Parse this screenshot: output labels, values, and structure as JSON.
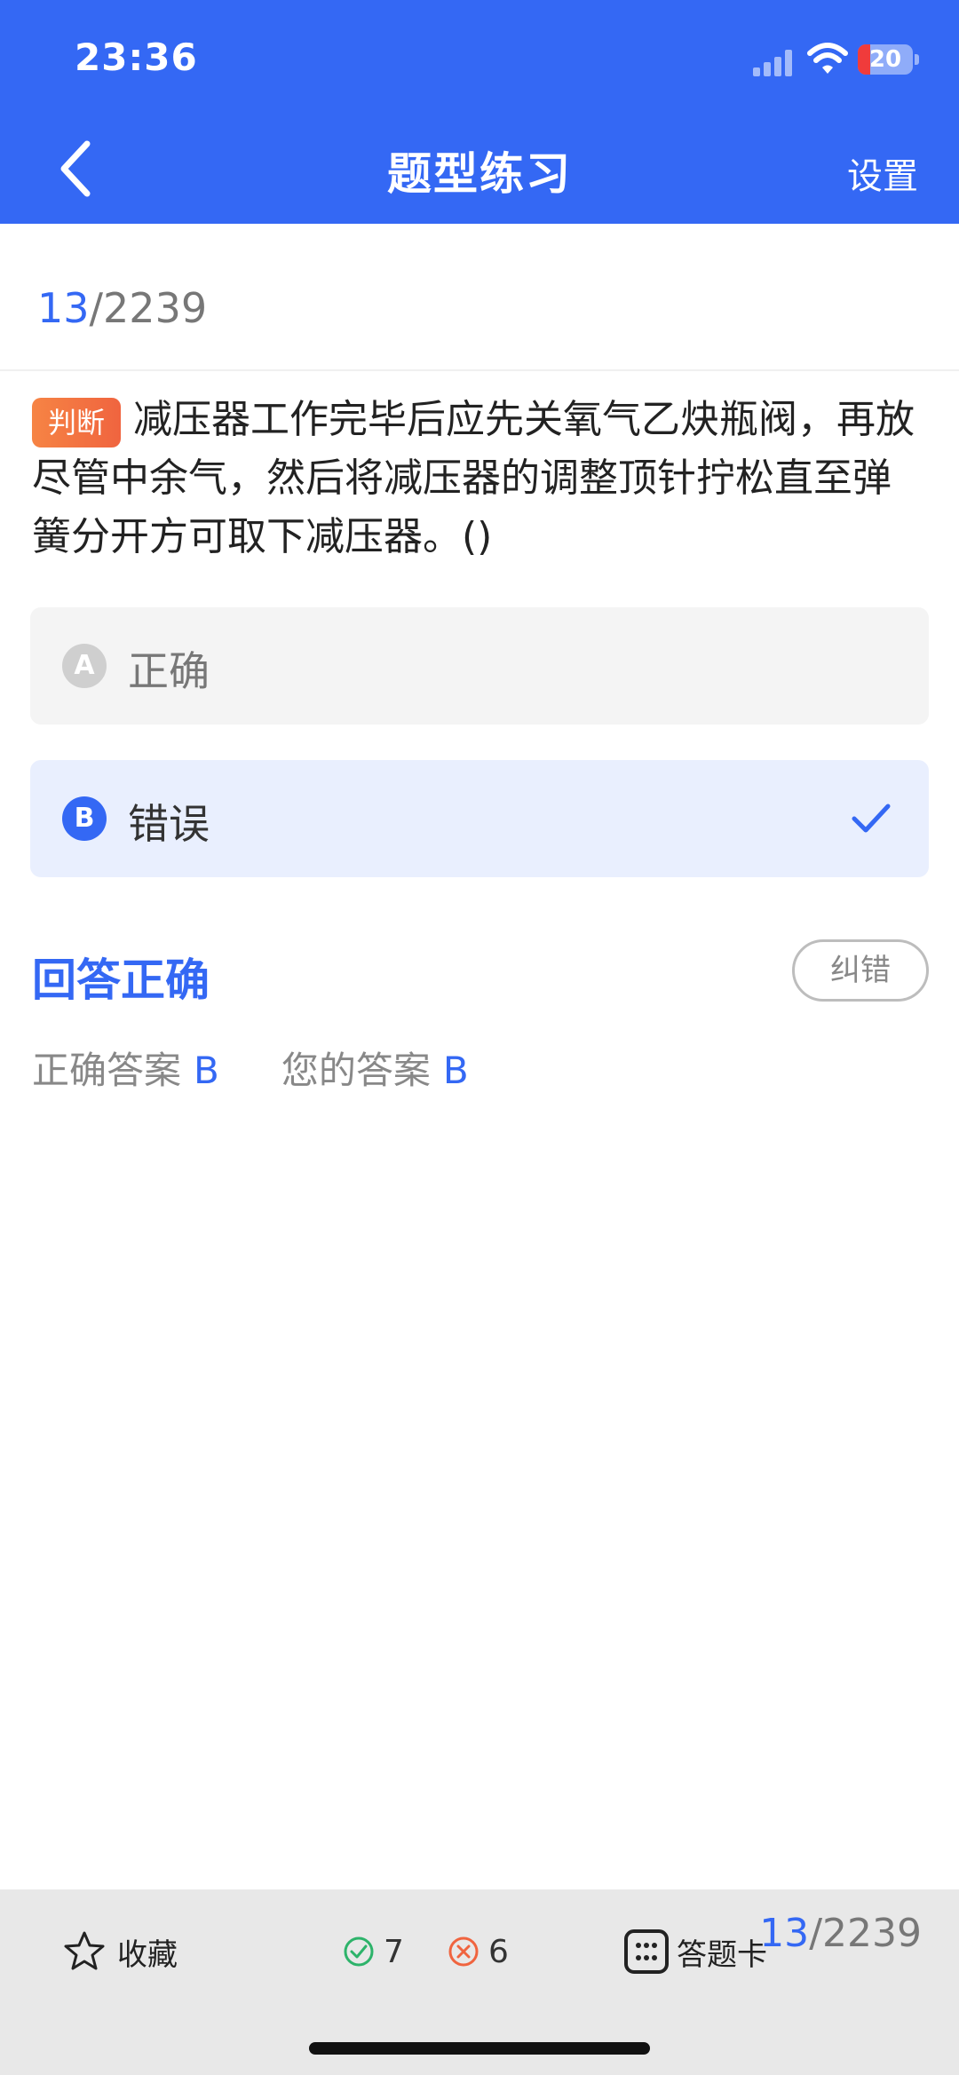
{
  "status_bar": {
    "time": "23:36",
    "battery": "20"
  },
  "header": {
    "title": "题型练习",
    "settings_label": "设置"
  },
  "progress": {
    "current": "13",
    "total": "/2239"
  },
  "question": {
    "tag": "判断",
    "text": "减压器工作完毕后应先关氧气乙炔瓶阀，再放尽管中余气，然后将减压器的调整顶针拧松直至弹簧分开方可取下减压器。()"
  },
  "options": [
    {
      "letter": "A",
      "text": "正确",
      "selected": false
    },
    {
      "letter": "B",
      "text": "错误",
      "selected": true
    }
  ],
  "result": {
    "title": "回答正确",
    "report_button": "纠错",
    "correct_label": "正确答案",
    "correct_value": "B",
    "your_label": "您的答案",
    "your_value": "B"
  },
  "bottom_bar": {
    "favorite_label": "收藏",
    "right_count": "7",
    "wrong_count": "6",
    "answer_card_label": "答题卡",
    "current": "13",
    "total": "/2239"
  },
  "colors": {
    "primary": "#3468F4",
    "tag": "#F0643F",
    "right": "#2DB36A",
    "wrong": "#F0643F"
  },
  "icons": [
    "back-arrow-icon",
    "signal-icon",
    "wifi-icon",
    "battery-icon",
    "check-icon",
    "star-icon",
    "right-circle-icon",
    "wrong-circle-icon",
    "grid-card-icon"
  ]
}
